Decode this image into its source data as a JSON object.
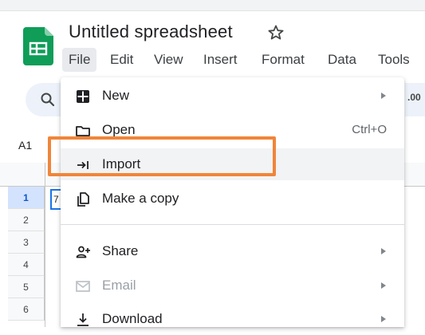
{
  "document": {
    "title": "Untitled spreadsheet"
  },
  "menubar": {
    "items": [
      "File",
      "Edit",
      "View",
      "Insert",
      "Format",
      "Data",
      "Tools"
    ],
    "active": "File"
  },
  "toolbar": {
    "partial_text": ".00"
  },
  "namebox": {
    "value": "A1"
  },
  "grid": {
    "row_labels": [
      "1",
      "2",
      "3",
      "4",
      "5",
      "6"
    ],
    "selected_row": "1",
    "a1_partial": "7"
  },
  "file_menu": {
    "items": [
      {
        "label": "New",
        "icon": "new-sheet-icon",
        "submenu": true
      },
      {
        "label": "Open",
        "icon": "folder-icon",
        "shortcut": "Ctrl+O"
      },
      {
        "label": "Import",
        "icon": "import-icon",
        "hovered": true
      },
      {
        "label": "Make a copy",
        "icon": "copy-icon"
      },
      {
        "label": "Share",
        "icon": "share-person-icon",
        "submenu": true
      },
      {
        "label": "Email",
        "icon": "email-icon",
        "submenu": true,
        "disabled": true
      },
      {
        "label": "Download",
        "icon": "download-icon",
        "submenu": true
      }
    ]
  },
  "colors": {
    "highlight": "#f0853a",
    "sheets_green": "#0f9d58",
    "selection_blue": "#1a73e8"
  }
}
